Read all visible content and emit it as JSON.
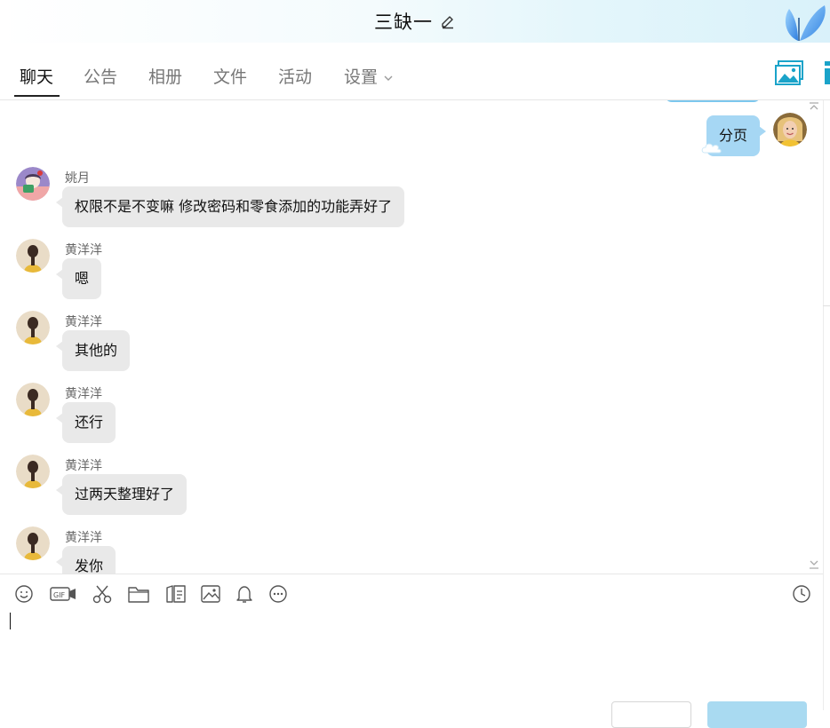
{
  "header": {
    "title": "三缺一"
  },
  "tabs": [
    {
      "label": "聊天"
    },
    {
      "label": "公告"
    },
    {
      "label": "相册"
    },
    {
      "label": "文件"
    },
    {
      "label": "活动"
    },
    {
      "label": "设置"
    }
  ],
  "my_message": {
    "text": "分页"
  },
  "messages": [
    {
      "sender": "姚月",
      "text": "权限不是不变嘛 修改密码和零食添加的功能弄好了"
    },
    {
      "sender": "黄洋洋",
      "text": "嗯"
    },
    {
      "sender": "黄洋洋",
      "text": "其他的"
    },
    {
      "sender": "黄洋洋",
      "text": "还行"
    },
    {
      "sender": "黄洋洋",
      "text": "过两天整理好了"
    },
    {
      "sender": "黄洋洋",
      "text": "发你"
    }
  ],
  "toolbar": {
    "icons": [
      "emoji-icon",
      "gif-icon",
      "scissors-icon",
      "folder-icon",
      "file-transfer-icon",
      "image-icon",
      "bell-icon",
      "more-icon",
      "history-icon"
    ]
  },
  "colors": {
    "my_bubble": "#a6d7f4",
    "other_bubble": "#e9e9e9",
    "accent": "#2a9fd6"
  }
}
